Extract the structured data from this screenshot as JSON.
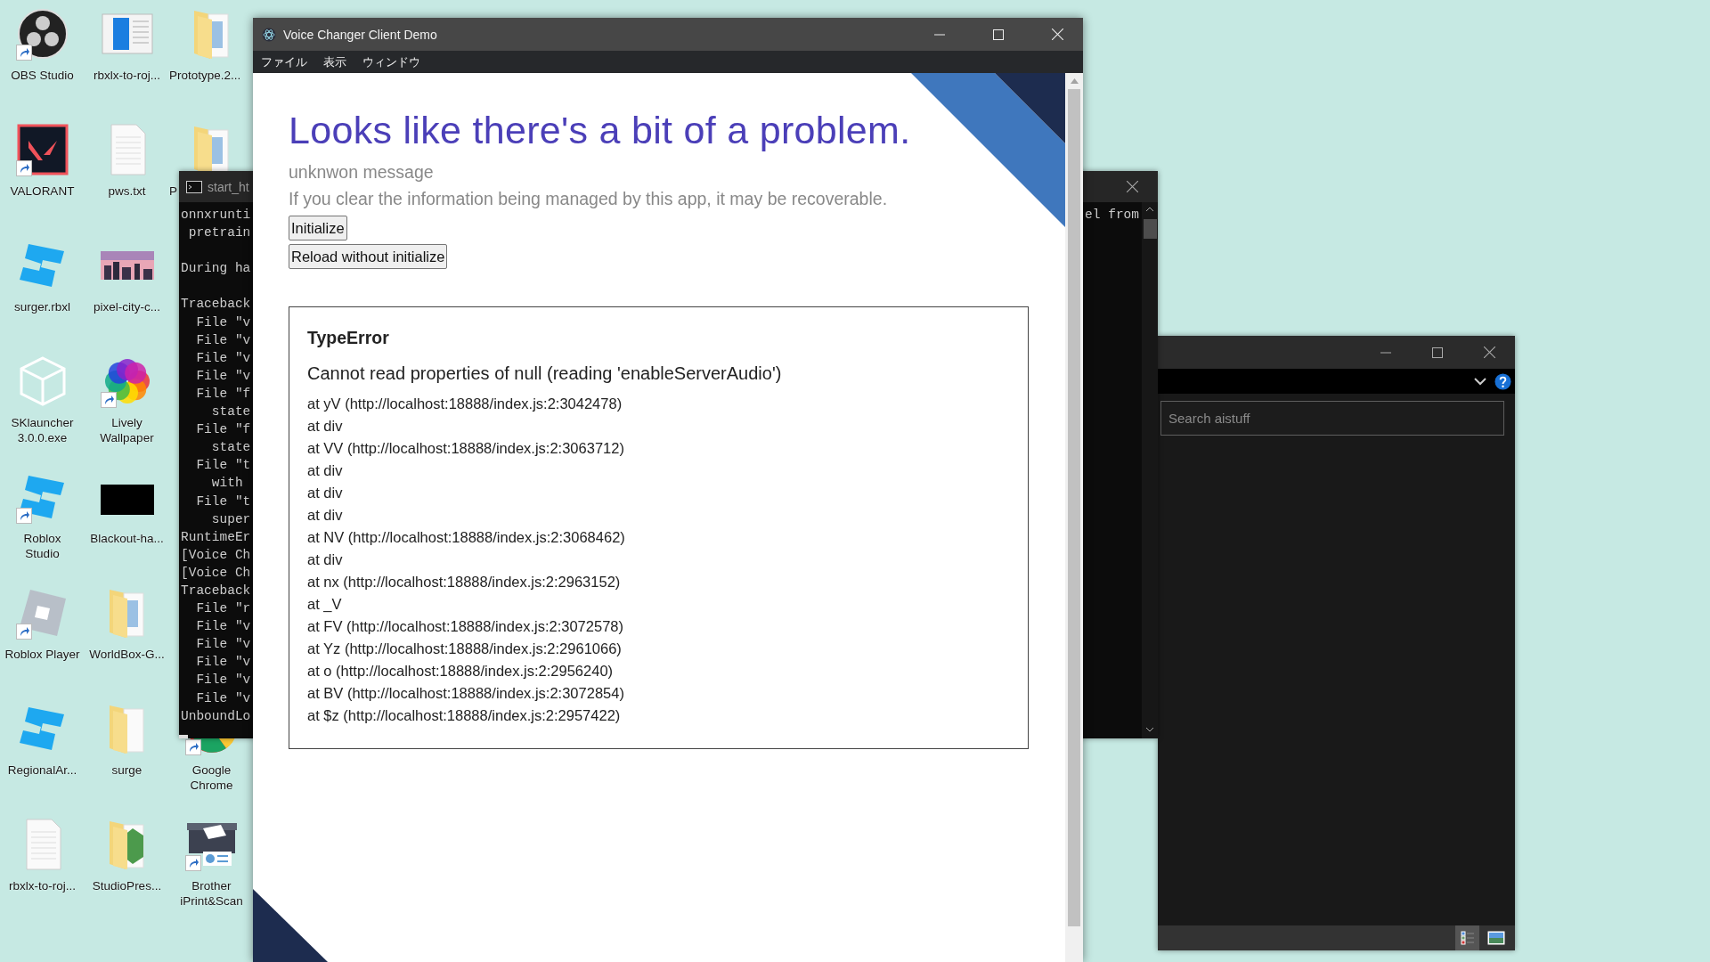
{
  "desktop": {
    "columns": [
      {
        "top": [
          {
            "label": "OBS Studio",
            "kind": "obs",
            "shortcut": true
          },
          {
            "label": "VALORANT",
            "kind": "valorant",
            "shortcut": true
          },
          {
            "label": "surger.rbxl",
            "kind": "studio",
            "shortcut": false
          },
          {
            "label": "SKlauncher\n3.0.0.exe",
            "kind": "cube",
            "shortcut": false
          },
          {
            "label": "Roblox\nStudio",
            "kind": "studio",
            "shortcut": true
          },
          {
            "label": "Roblox Player",
            "kind": "player",
            "shortcut": true
          },
          {
            "label": "RegionalAr...",
            "kind": "studio",
            "shortcut": false
          },
          {
            "label": "rbxlx-to-roj...",
            "kind": "text",
            "shortcut": false
          }
        ]
      },
      {
        "top": [
          {
            "label": "rbxlx-to-roj...",
            "kind": "window",
            "shortcut": false
          },
          {
            "label": "pws.txt",
            "kind": "text",
            "shortcut": false
          },
          {
            "label": "pixel-city-c...",
            "kind": "picture",
            "shortcut": false
          },
          {
            "label": "Lively\nWallpaper",
            "kind": "flower",
            "shortcut": true
          },
          {
            "label": "Blackout-ha...",
            "kind": "black",
            "shortcut": false
          },
          {
            "label": "WorldBox-G...",
            "kind": "folder",
            "shortcut": false
          },
          {
            "label": "surge",
            "kind": "folder-blank",
            "shortcut": false
          },
          {
            "label": "StudioPres...",
            "kind": "folder-leaf",
            "shortcut": false
          }
        ]
      },
      {
        "top": [
          {
            "label": "Prototype.2...",
            "kind": "folder",
            "shortcut": false
          },
          {
            "label": "P",
            "kind": "folder",
            "shortcut": false
          }
        ],
        "bottom": [
          {
            "label": "Google\nChrome",
            "kind": "chrome",
            "shortcut": true
          },
          {
            "label": "Brother\niPrint&Scan",
            "kind": "scanner",
            "shortcut": true
          }
        ]
      }
    ]
  },
  "explorer_window": {
    "search": {
      "placeholder": "Search aistuff"
    }
  },
  "terminal_window": {
    "title": "start_ht",
    "right_text": "el from",
    "blocks": [
      [
        "onnxrunti",
        " pretrain"
      ],
      [
        "During ha"
      ],
      [
        "Traceback",
        "  File \"v",
        "  File \"v",
        "  File \"v",
        "  File \"v",
        "  File \"f",
        "    state",
        "  File \"f",
        "    state",
        "  File \"t",
        "    with",
        "  File \"t",
        "    super",
        "RuntimeEr",
        "[Voice Ch",
        "[Voice Ch",
        "Traceback",
        "  File \"r",
        "  File \"v",
        "  File \"v",
        "  File \"v",
        "  File \"v",
        "  File \"v",
        "UnboundLo"
      ]
    ]
  },
  "app_window": {
    "title": "Voice Changer Client Demo",
    "menu": [
      "ファイル",
      "表示",
      "ウィンドウ"
    ],
    "heading": "Looks like there's a bit of a problem.",
    "message": "unknwon message",
    "hint": "If you clear the information being managed by this app, it may be recoverable.",
    "buttons": [
      "Initialize",
      "Reload without initialize"
    ],
    "error": {
      "name": "TypeError",
      "message": "Cannot read properties of null (reading 'enableServerAudio')",
      "stack": [
        "at yV (http://localhost:18888/index.js:2:3042478)",
        "at div",
        "at VV (http://localhost:18888/index.js:2:3063712)",
        "at div",
        "at div",
        "at div",
        "at NV (http://localhost:18888/index.js:2:3068462)",
        "at div",
        "at nx (http://localhost:18888/index.js:2:2963152)",
        "at _V",
        "at FV (http://localhost:18888/index.js:2:3072578)",
        "at Yz (http://localhost:18888/index.js:2:2961066)",
        "at o (http://localhost:18888/index.js:2:2956240)",
        "at BV (http://localhost:18888/index.js:2:3072854)",
        "at $z (http://localhost:18888/index.js:2:2957422)"
      ]
    }
  }
}
